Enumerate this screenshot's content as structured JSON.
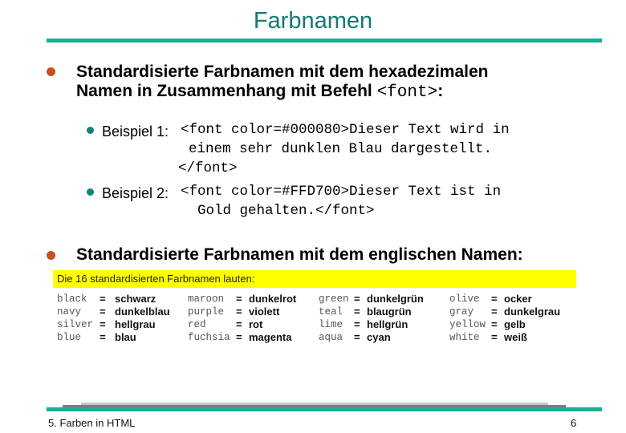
{
  "slide": {
    "title": "Farbnamen",
    "accent_color": "#16b18f",
    "title_color": "#137a73"
  },
  "bullets": [
    {
      "line1": "Standardisierte Farbnamen mit dem hexadezimalen",
      "line2_prefix": "Namen in Zusammenhang mit Befehl ",
      "line2_code": "<font>",
      "line2_suffix": ":",
      "sub": [
        {
          "label": "Beispiel 1:",
          "code_lines": [
            "<font color=#000080>Dieser Text wird in",
            "einem sehr dunklen Blau dargestellt.",
            "</font>"
          ]
        },
        {
          "label": "Beispiel 2:",
          "code_lines": [
            "<font color=#FFD700>Dieser Text ist in",
            "Gold gehalten.</font>"
          ]
        }
      ]
    },
    {
      "line1": "Standardisierte Farbnamen mit dem englischen Namen:"
    }
  ],
  "color_table": {
    "heading": "Die 16 standardisierten Farbnamen lauten:",
    "highlight_color": "#ffff00",
    "columns": [
      [
        {
          "en": "black",
          "de": "schwarz"
        },
        {
          "en": "navy",
          "de": "dunkelblau"
        },
        {
          "en": "silver",
          "de": "hellgrau"
        },
        {
          "en": "blue",
          "de": "blau"
        }
      ],
      [
        {
          "en": "maroon",
          "de": "dunkelrot"
        },
        {
          "en": "purple",
          "de": "violett"
        },
        {
          "en": "red",
          "de": "rot"
        },
        {
          "en": "fuchsia",
          "de": "magenta"
        }
      ],
      [
        {
          "en": "green",
          "de": "dunkelgrün"
        },
        {
          "en": "teal",
          "de": "blaugrün"
        },
        {
          "en": "lime",
          "de": "hellgrün"
        },
        {
          "en": "aqua",
          "de": "cyan"
        }
      ],
      [
        {
          "en": "olive",
          "de": "ocker"
        },
        {
          "en": "gray",
          "de": "dunkelgrau"
        },
        {
          "en": "yellow",
          "de": "gelb"
        },
        {
          "en": "white",
          "de": "weiß"
        }
      ]
    ],
    "equals": "="
  },
  "footer": {
    "left": "5. Farben in HTML",
    "right": "6"
  }
}
